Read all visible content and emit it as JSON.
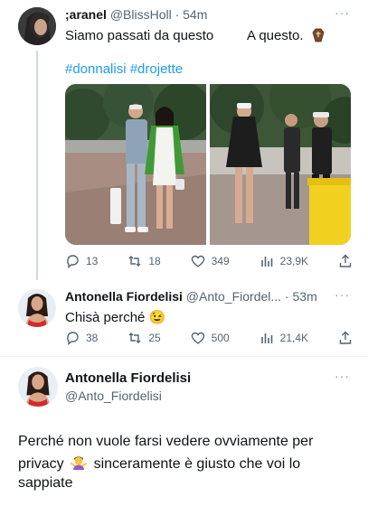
{
  "tweet1": {
    "name": ";aranel",
    "handle": "@BlissHoll",
    "time": "· 54m",
    "more": "···",
    "text_left": "Siamo passati da questo",
    "text_right": "A questo.",
    "emoji": "coffin",
    "hashtags": "#donnalisi #drojette",
    "actions": {
      "replies": "13",
      "retweets": "18",
      "likes": "349",
      "views": "23,9K"
    }
  },
  "tweet2": {
    "name": "Antonella Fiordelisi",
    "handle": "@Anto_Fiordel...",
    "time": "· 53m",
    "more": "···",
    "text": "Chisà perché",
    "emoji": "😉",
    "actions": {
      "replies": "38",
      "retweets": "25",
      "likes": "500",
      "views": "21,4K"
    }
  },
  "tweet3": {
    "name": "Antonella Fiordelisi",
    "handle": "@Anto_Fiordelisi",
    "more": "···",
    "line1": "Perché non vuole farsi vedere ovviamente per",
    "line2_a": "privacy",
    "line2_b": "sinceramente è giusto che voi lo",
    "line3": "sappiate"
  },
  "colors": {
    "accent": "#1d9bf0",
    "secondary_text": "#536471",
    "divider": "#eff3f4"
  }
}
